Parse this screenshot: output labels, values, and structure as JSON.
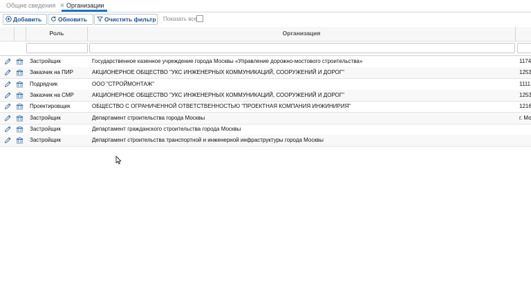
{
  "tabs": {
    "general": "Общие сведения",
    "general_close": "✕",
    "organizations": "Организации"
  },
  "toolbar": {
    "add": "Добавить",
    "refresh": "Обновить",
    "clear_filter": "Очистить фильтр",
    "show_all": "Показать все:",
    "show_all_checked": false
  },
  "table": {
    "columns": {
      "role": "Роль",
      "organization": "Организация"
    },
    "rows": [
      {
        "role": "Застройщик",
        "org": "Государственное казенное учреждение города Москвы «Управление дорожно-мостового строительства»",
        "extra": "1174"
      },
      {
        "role": "Заказчик на ПИР",
        "org": "АКЦИОНЕРНОЕ ОБЩЕСТВО \"УКС ИНЖЕНЕРНЫХ КОММУНИКАЦИЙ, СООРУЖЕНИЙ И ДОРОГ\"",
        "extra": "1253"
      },
      {
        "role": "Подрядчик",
        "org": "ООО \"СТРОЙМОНТАЖ\"",
        "extra": "1111"
      },
      {
        "role": "Заказчик на СМР",
        "org": "АКЦИОНЕРНОЕ ОБЩЕСТВО \"УКС ИНЖЕНЕРНЫХ КОММУНИКАЦИЙ, СООРУЖЕНИЙ И ДОРОГ\"",
        "extra": "1253"
      },
      {
        "role": "Проектировщик",
        "org": "ОБЩЕСТВО С ОГРАНИЧЕННОЙ ОТВЕТСТВЕННОСТЬЮ \"ПРОЕКТНАЯ КОМПАНИЯ ИНЖИНИРИЯ\"",
        "extra": "1216"
      },
      {
        "role": "Застройщик",
        "org": "Департамент строительства города Москвы",
        "extra": "г. Мо"
      },
      {
        "role": "Застройщик",
        "org": "Департамент гражданского строительства города Москвы",
        "extra": ""
      },
      {
        "role": "Застройщик",
        "org": "Департамент строительства транспортной и инженерной инфраструктуры города Москвы",
        "extra": ""
      }
    ]
  },
  "icons": {
    "edit": "pencil-icon",
    "bank": "bank-icon",
    "add": "plus-circle-icon",
    "refresh": "refresh-icon",
    "filter": "filter-icon"
  },
  "colors": {
    "accent": "#1a73c8",
    "button_text": "#1d4e87"
  }
}
